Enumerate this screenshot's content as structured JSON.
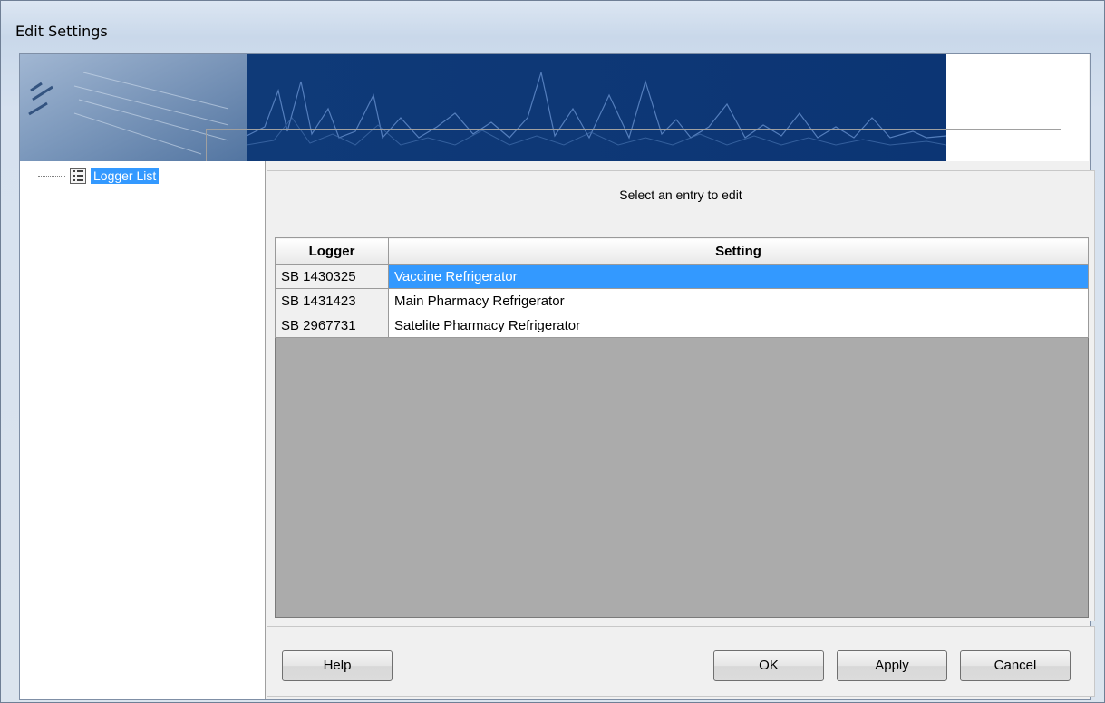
{
  "window": {
    "title": "Edit Settings"
  },
  "tree": {
    "items": [
      {
        "label": "Logger List",
        "icon": "list-icon",
        "selected": true
      }
    ]
  },
  "main": {
    "prompt": "Select an entry to edit",
    "table": {
      "columns": [
        "Logger",
        "Setting"
      ],
      "rows": [
        {
          "logger": "SB 1430325",
          "setting": "Vaccine Refrigerator",
          "selected": true
        },
        {
          "logger": "SB 1431423",
          "setting": "Main Pharmacy Refrigerator",
          "selected": false
        },
        {
          "logger": "SB 2967731",
          "setting": "Satelite Pharmacy Refrigerator",
          "selected": false
        }
      ]
    }
  },
  "buttons": {
    "help": "Help",
    "ok": "OK",
    "apply": "Apply",
    "cancel": "Cancel"
  },
  "colors": {
    "selection": "#3399ff",
    "banner": "#0f3d7a"
  }
}
